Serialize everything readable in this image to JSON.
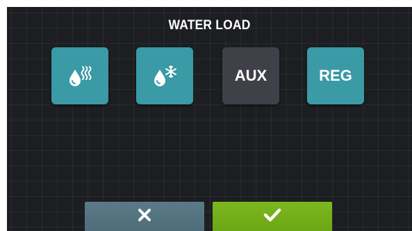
{
  "screen": {
    "title": "WATER LOAD"
  },
  "options": [
    {
      "id": "hot",
      "icon": "hot-water-drop-icon",
      "label": "",
      "state": "active",
      "color": "#3a9aa6"
    },
    {
      "id": "cold",
      "icon": "cold-water-drop-icon",
      "label": "",
      "state": "active",
      "color": "#3a9aa6"
    },
    {
      "id": "aux",
      "icon": "",
      "label": "AUX",
      "state": "inactive",
      "color": "#404148"
    },
    {
      "id": "reg",
      "icon": "",
      "label": "REG",
      "state": "active",
      "color": "#3a9aa6"
    }
  ],
  "buttons": {
    "cancel": {
      "icon": "close-icon",
      "color": "#4f6e7c"
    },
    "confirm": {
      "icon": "check-icon",
      "color": "#72ad17"
    }
  },
  "theme": {
    "background": "#1c1e21",
    "text": "#ffffff"
  }
}
